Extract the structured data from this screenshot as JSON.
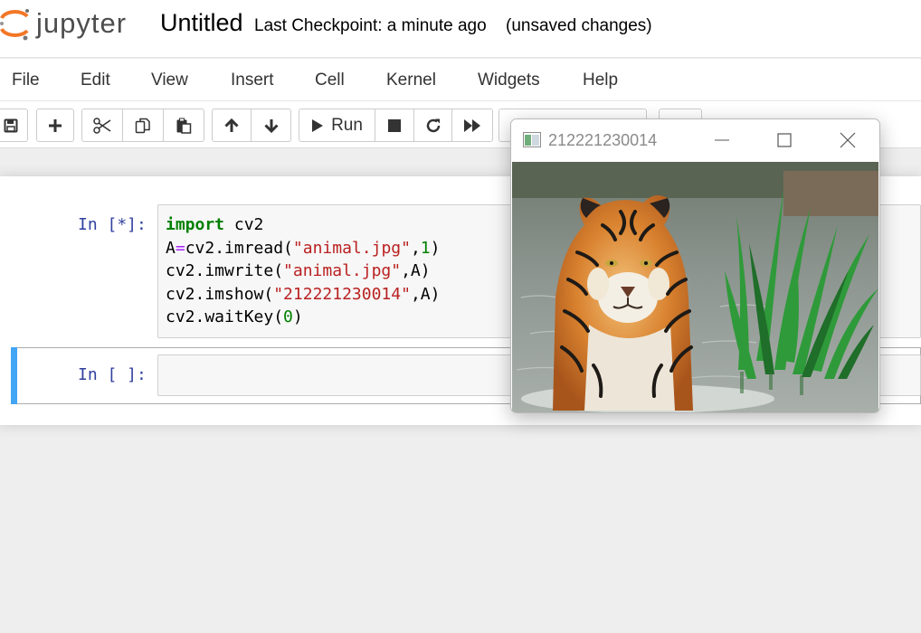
{
  "header": {
    "logo_text": "jupyter",
    "notebook_name": "Untitled",
    "checkpoint": "Last Checkpoint: a minute ago",
    "autosave": "(unsaved changes)"
  },
  "menubar": {
    "items": [
      "File",
      "Edit",
      "View",
      "Insert",
      "Cell",
      "Kernel",
      "Widgets",
      "Help"
    ]
  },
  "toolbar": {
    "run_label": "Run",
    "icons": [
      "save-icon",
      "plus-icon",
      "cut-icon",
      "copy-icon",
      "paste-icon",
      "arrow-up-icon",
      "arrow-down-icon",
      "play-icon",
      "stop-icon",
      "restart-icon",
      "fast-forward-icon"
    ]
  },
  "cells": [
    {
      "prompt": "In [*]:",
      "code": [
        "import cv2",
        "A=cv2.imread(\"animal.jpg\",1)",
        "cv2.imwrite(\"animal.jpg\",A)",
        "cv2.imshow(\"212221230014\",A)",
        "cv2.waitKey(0)"
      ],
      "tokens": {
        "import": "import",
        "module": " cv2",
        "l2a": "A",
        "l2op": "=",
        "l2b": "cv2.imread(",
        "l2s": "\"animal.jpg\"",
        "l2c": ",",
        "l2n": "1",
        "l2d": ")",
        "l3a": "cv2.imwrite(",
        "l3s": "\"animal.jpg\"",
        "l3b": ",A)",
        "l4a": "cv2.imshow(",
        "l4s": "\"212221230014\"",
        "l4b": ",A)",
        "l5a": "cv2.waitKey(",
        "l5n": "0",
        "l5b": ")"
      }
    },
    {
      "prompt": "In [ ]:",
      "code": []
    }
  ],
  "popup_window": {
    "title": "212221230014",
    "image_subject": "tiger standing in water beside green grass"
  },
  "colors": {
    "prompt": "#303f9f",
    "keyword": "#008000",
    "string": "#ba2121",
    "operator": "#aa22ff",
    "selected_bar": "#42a5f5"
  }
}
